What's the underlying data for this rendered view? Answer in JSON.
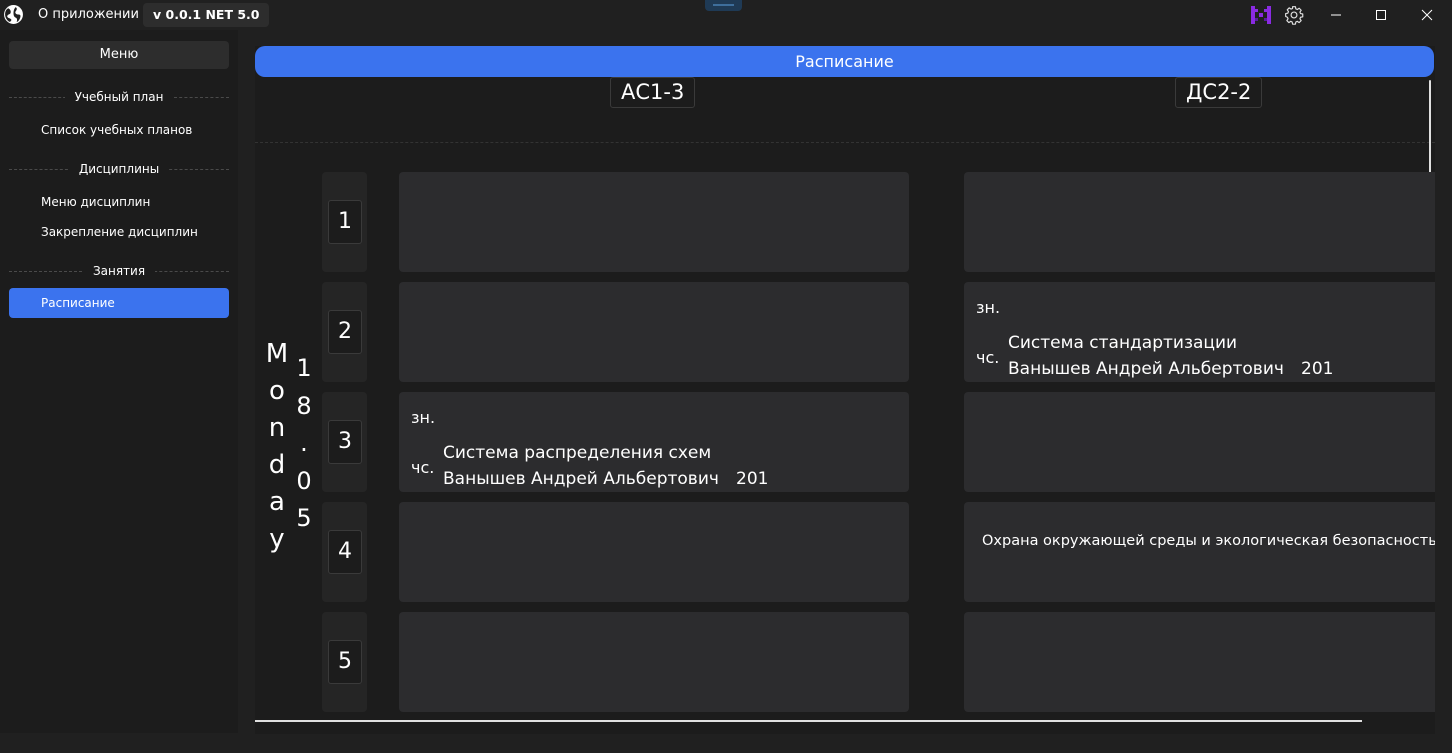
{
  "titlebar": {
    "about": "О приложении",
    "version": "v 0.0.1 NET 5.0"
  },
  "sidebar": {
    "menu_label": "Меню",
    "sections": [
      {
        "title": "Учебный план",
        "items": [
          "Список учебных планов"
        ]
      },
      {
        "title": "Дисциплины",
        "items": [
          "Меню дисциплин",
          "Закрепление дисциплин"
        ]
      },
      {
        "title": "Занятия",
        "items": [
          "Расписание"
        ]
      }
    ],
    "active_item": "Расписание"
  },
  "schedule": {
    "title": "Расписание",
    "groups": [
      "АС1-3",
      "ДС2-2"
    ],
    "day": [
      "M",
      "o",
      "n",
      "d",
      "a",
      "y"
    ],
    "date": [
      "1",
      "8",
      ".",
      "0",
      "5"
    ],
    "pairs": [
      "1",
      "2",
      "3",
      "4",
      "5"
    ],
    "lessons": {
      "as13_p3": {
        "zn": "зн.",
        "chs": "чс.",
        "subject": "Система распределения схем",
        "teacher": "Ванышев Андрей Альбертович",
        "room": "201"
      },
      "ds22_p2": {
        "zn": "зн.",
        "chs": "чс.",
        "subject": "Система стандартизации",
        "teacher": "Ванышев Андрей Альбертович",
        "room": "201"
      },
      "ds22_p4": {
        "text": "Охрана окружающей среды и экологическая безопасность отр"
      }
    }
  },
  "colors": {
    "accent": "#3b73ee",
    "background": "#202020",
    "cell": "#2c2c2e"
  }
}
